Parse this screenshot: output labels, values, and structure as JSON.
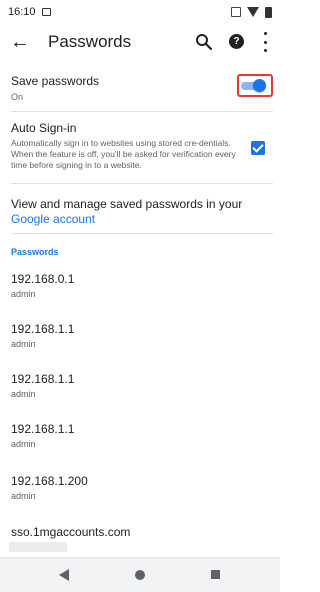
{
  "status_bar": {
    "time": "16:10"
  },
  "app_bar": {
    "title": "Passwords"
  },
  "save_passwords": {
    "title": "Save passwords",
    "state": "On",
    "enabled": true
  },
  "auto_signin": {
    "title": "Auto Sign-in",
    "description": "Automatically sign in to websites using stored cre-dentials. When the feature is off, you’ll be asked for verification every time before signing in to a website.",
    "checked": true
  },
  "manage": {
    "text": "View and manage saved passwords in your ",
    "link": "Google account"
  },
  "passwords_section": {
    "header": "Passwords"
  },
  "passwords": [
    {
      "site": "192.168.0.1",
      "username": "admin"
    },
    {
      "site": "192.168.1.1",
      "username": "admin"
    },
    {
      "site": "192.168.1.1",
      "username": "admin"
    },
    {
      "site": "192.168.1.1",
      "username": "admin"
    },
    {
      "site": "192.168.1.200",
      "username": "admin"
    },
    {
      "site": "sso.1mgaccounts.com",
      "username": ""
    }
  ],
  "colors": {
    "accent": "#1a73e8",
    "highlight": "#e53935"
  }
}
